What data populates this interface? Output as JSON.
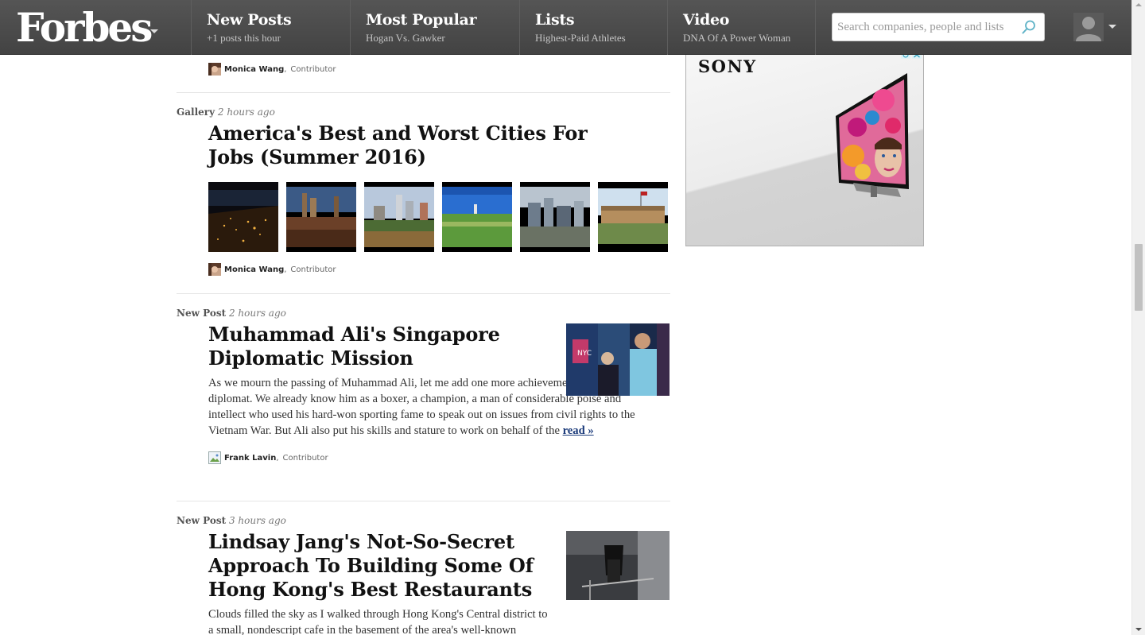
{
  "brand": {
    "logo": "Forbes"
  },
  "nav": [
    {
      "title": "New Posts",
      "subtitle": "+1 posts this hour"
    },
    {
      "title": "Most Popular",
      "subtitle": "Hogan Vs. Gawker"
    },
    {
      "title": "Lists",
      "subtitle": "Highest-Paid Athletes"
    },
    {
      "title": "Video",
      "subtitle": "DNA Of A Power Woman"
    }
  ],
  "search": {
    "placeholder": "Search companies, people and lists"
  },
  "feed": {
    "top_byline": {
      "author": "Monica Wang",
      "role": "Contributor"
    },
    "items": [
      {
        "type": "Gallery",
        "time": "2 hours ago",
        "headline": "America's Best and Worst Cities For Jobs (Summer 2016)",
        "author": "Monica Wang",
        "role": "Contributor"
      },
      {
        "type": "New Post",
        "time": "2 hours ago",
        "headline": "Muhammad Ali's Singapore Diplomatic Mission",
        "excerpt": "As we mourn the passing of Muhammad Ali, let me add one more achievement to our memory: diplomat. We already know him as a boxer, a champion, a man of considerable poise and intellect who used his hard-won sporting fame to speak out on issues from civil rights to the Vietnam War. But Ali also put his skills and stature to work on behalf of the",
        "read_more": "read »",
        "author": "Frank Lavin",
        "role": "Contributor"
      },
      {
        "type": "New Post",
        "time": "3 hours ago",
        "headline": "Lindsay Jang's Not-So-Secret Approach To Building Some Of Hong Kong's Best Restaurants",
        "excerpt": "Clouds filled the sky as I walked through Hong Kong's Central district to a small, nondescript cafe in the basement of the area's well-known"
      }
    ]
  },
  "ad": {
    "brand": "SONY"
  },
  "colors": {
    "nav_bg": "#4a4a4a",
    "link": "#1a3a7a",
    "divider": "#e5e5e5"
  }
}
